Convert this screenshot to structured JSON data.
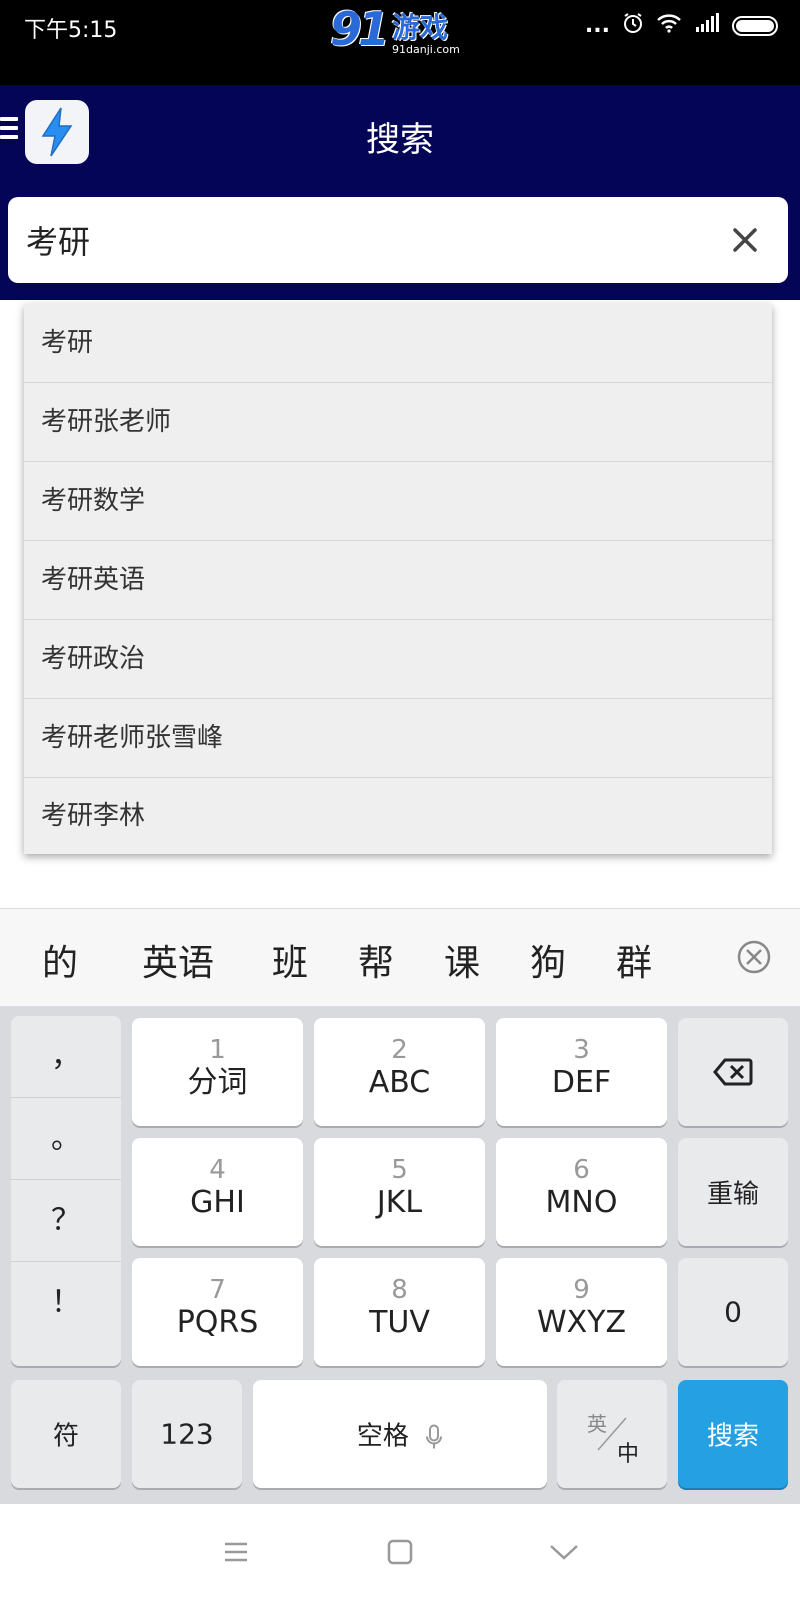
{
  "status_bar": {
    "time": "下午5:15",
    "watermark_logo": "91",
    "watermark_name": "游戏",
    "watermark_url": "91danji.com",
    "dots": "..."
  },
  "header": {
    "title": "搜索"
  },
  "search": {
    "value": "考研"
  },
  "suggestions": [
    "考研",
    "考研张老师",
    "考研数学",
    "考研英语",
    "考研政治",
    "考研老师张雪峰",
    "考研李林"
  ],
  "candidates": [
    "的",
    "英语",
    "班",
    "帮",
    "课",
    "狗",
    "群"
  ],
  "keyboard": {
    "punctuation": [
      "，",
      "。",
      "？",
      "！"
    ],
    "keys": [
      {
        "num": "1",
        "letters": "分词"
      },
      {
        "num": "2",
        "letters": "ABC"
      },
      {
        "num": "3",
        "letters": "DEF"
      },
      {
        "num": "4",
        "letters": "GHI"
      },
      {
        "num": "5",
        "letters": "JKL"
      },
      {
        "num": "6",
        "letters": "MNO"
      },
      {
        "num": "7",
        "letters": "PQRS"
      },
      {
        "num": "8",
        "letters": "TUV"
      },
      {
        "num": "9",
        "letters": "WXYZ"
      }
    ],
    "reinput": "重输",
    "zero": "0",
    "symbols": "符",
    "numbers": "123",
    "space": "空格",
    "lang_en": "英",
    "lang_zh": "中",
    "search": "搜索"
  },
  "colors": {
    "header_bg": "#050558",
    "search_key": "#25a0e2",
    "logo_bolt": "#2a8ef0"
  }
}
